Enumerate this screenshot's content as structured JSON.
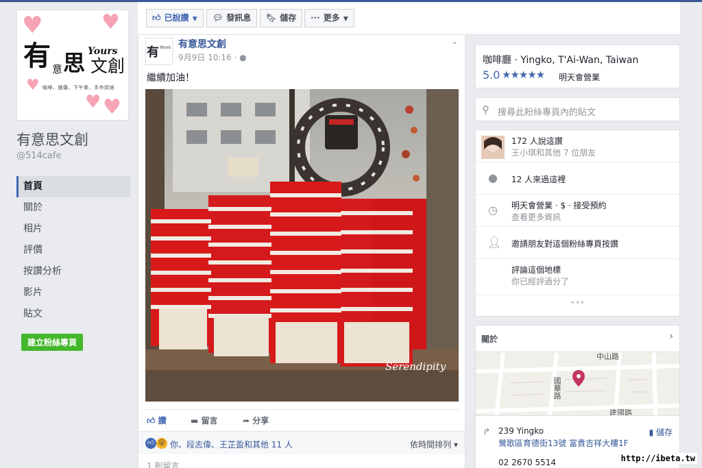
{
  "page": {
    "name": "有意思文創",
    "handle": "@514cafe",
    "logo": {
      "big_char": "有",
      "small_char1": "意",
      "mid_char": "思",
      "small_char2": "文創",
      "yours": "Yours",
      "tagline": "咖啡、披薩、下午茶、手作烘焙"
    }
  },
  "nav": {
    "items": [
      "首頁",
      "關於",
      "相片",
      "評價",
      "按讚分析",
      "影片",
      "貼文"
    ],
    "active_index": 0,
    "create_page_label": "建立粉絲專頁"
  },
  "actionbar": {
    "liked_label": "已說讚",
    "message_label": "發訊息",
    "save_label": "儲存",
    "more_label": "更多"
  },
  "post": {
    "author": "有意思文創",
    "time": "9月9日 10:16 · ",
    "text": "繼續加油！",
    "photo_watermark": "Serendipity",
    "actions": {
      "like": "讚",
      "comment": "留言",
      "share": "分享"
    },
    "reactions_text": "你、段志偉、王芷盈和其他 11 人",
    "sort_label": "依時間排列",
    "comments_count": "1 則留言"
  },
  "info": {
    "category_location": "咖啡廳 · Yingko, T'Ai-Wan, Taiwan",
    "rating": "5.0",
    "stars": "★★★★★",
    "open_status": "明天會營業"
  },
  "search": {
    "placeholder": "搜尋此粉絲專頁內的貼文"
  },
  "details": {
    "likes_line1": "172 人說這讚",
    "likes_line2": "王小琪和其他 7 位朋友",
    "checkins": "12 人來過這裡",
    "hours_line1": "明天會營業 · $ · 接受預約",
    "hours_line2": "查看更多資訊",
    "invite": "邀請朋友對這個粉絲專頁按讚",
    "review_line1": "評論這個地標",
    "review_line2": "你已經評過分了"
  },
  "about": {
    "title": "關於",
    "map_labels": {
      "road1": "中山路",
      "road2": "國華路",
      "road3": "建國路"
    },
    "address_line1": "239 Yingko",
    "address_line2": "鶯歌區育德街13號 富貴吉祥大樓1F",
    "save_label": "儲存",
    "phone": "02 2670 5514"
  },
  "watermark": "http://ibeta.tw",
  "colors": {
    "accent": "#4267b2",
    "link": "#365899",
    "green": "#42b72a",
    "box_red": "#d8191a"
  }
}
